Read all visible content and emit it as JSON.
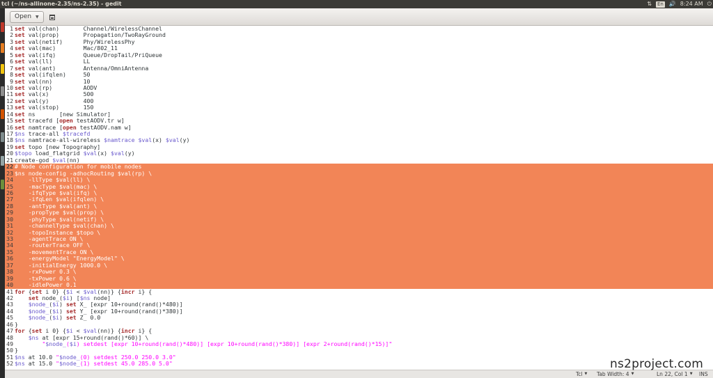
{
  "window": {
    "title": "tcl (~/ns-allinone-2.35/ns-2.35) - gedit"
  },
  "tray": {
    "keyboard": "En",
    "volume_icon": "speaker-icon",
    "time": "8:24 AM",
    "user": "L"
  },
  "toolbar": {
    "open_label": "Open"
  },
  "colors": {
    "selection": "#f28557",
    "keyword": "#a52a2a",
    "variable": "#6a5acd",
    "string": "#ff00ff",
    "comment": "#0000ff"
  },
  "editor": {
    "lines": [
      {
        "n": "1",
        "text": "set val(chan)       Channel/WirelessChannel"
      },
      {
        "n": "2",
        "text": "set val(prop)       Propagation/TwoRayGround"
      },
      {
        "n": "3",
        "text": "set val(netif)      Phy/WirelessPhy"
      },
      {
        "n": "4",
        "text": "set val(mac)        Mac/802_11"
      },
      {
        "n": "5",
        "text": "set val(ifq)        Queue/DropTail/PriQueue"
      },
      {
        "n": "6",
        "text": "set val(ll)         LL"
      },
      {
        "n": "7",
        "text": "set val(ant)        Antenna/OmniAntenna"
      },
      {
        "n": "8",
        "text": "set val(ifqlen)     50"
      },
      {
        "n": "9",
        "text": "set val(nn)         10"
      },
      {
        "n": "10",
        "text": "set val(rp)         AODV"
      },
      {
        "n": "11",
        "text": "set val(x)          500"
      },
      {
        "n": "12",
        "text": "set val(y)          400"
      },
      {
        "n": "13",
        "text": "set val(stop)       150"
      },
      {
        "n": "14",
        "text": "set ns       [new Simulator]"
      },
      {
        "n": "15",
        "text": "set tracefd [open testAODV.tr w]"
      },
      {
        "n": "16",
        "text": "set namtrace [open testAODV.nam w]"
      },
      {
        "n": "17",
        "text": "$ns trace-all $tracefd"
      },
      {
        "n": "18",
        "text": "$ns namtrace-all-wireless $namtrace $val(x) $val(y)"
      },
      {
        "n": "19",
        "text": "set topo [new Topography]"
      },
      {
        "n": "20",
        "text": "$topo load_flatgrid $val(x) $val(y)"
      },
      {
        "n": "21",
        "text": "create-god $val(nn)"
      },
      {
        "n": "22",
        "text": "# Node configuration for mobile nodes",
        "hl": true
      },
      {
        "n": "23",
        "text": "$ns node-config -adhocRouting $val(rp) \\",
        "hl": true
      },
      {
        "n": "24",
        "text": "    -llType $val(ll) \\",
        "hl": true
      },
      {
        "n": "25",
        "text": "    -macType $val(mac) \\",
        "hl": true
      },
      {
        "n": "26",
        "text": "    -ifqType $val(ifq) \\",
        "hl": true
      },
      {
        "n": "27",
        "text": "    -ifqLen $val(ifqlen) \\",
        "hl": true
      },
      {
        "n": "28",
        "text": "    -antType $val(ant) \\",
        "hl": true
      },
      {
        "n": "29",
        "text": "    -propType $val(prop) \\",
        "hl": true
      },
      {
        "n": "30",
        "text": "    -phyType $val(netif) \\",
        "hl": true
      },
      {
        "n": "31",
        "text": "    -channelType $val(chan) \\",
        "hl": true
      },
      {
        "n": "32",
        "text": "    -topoInstance $topo \\",
        "hl": true
      },
      {
        "n": "33",
        "text": "    -agentTrace ON \\",
        "hl": true
      },
      {
        "n": "34",
        "text": "    -routerTrace OFF \\",
        "hl": true
      },
      {
        "n": "35",
        "text": "    -movementTrace ON \\",
        "hl": true
      },
      {
        "n": "36",
        "text": "    -energyModel \"EnergyModel\" \\",
        "hl": true
      },
      {
        "n": "37",
        "text": "    -initialEnergy 1000.0 \\",
        "hl": true
      },
      {
        "n": "38",
        "text": "    -rxPower 0.3 \\",
        "hl": true
      },
      {
        "n": "39",
        "text": "    -txPower 0.6 \\",
        "hl": true
      },
      {
        "n": "40",
        "text": "    -idlePower 0.1",
        "hl": true
      },
      {
        "n": "41",
        "text": "for {set i 0} {$i < $val(nn)} {incr i} {"
      },
      {
        "n": "42",
        "text": "    set node_($i) [$ns node]"
      },
      {
        "n": "43",
        "text": "    $node_($i) set X_ [expr 10+round(rand()*480)]"
      },
      {
        "n": "44",
        "text": "    $node_($i) set Y_ [expr 10+round(rand()*380)]"
      },
      {
        "n": "45",
        "text": "    $node_($i) set Z_ 0.0"
      },
      {
        "n": "46",
        "text": "}"
      },
      {
        "n": "47",
        "text": "for {set i 0} {$i < $val(nn)} {incr i} {"
      },
      {
        "n": "48",
        "text": "    $ns at [expr 15+round(rand()*60)] \\"
      },
      {
        "n": "49",
        "text": "        \"$node_($i) setdest [expr 10+round(rand()*480)] [expr 10+round(rand()*380)] [expr 2+round(rand()*15)]\""
      },
      {
        "n": "50",
        "text": "}"
      },
      {
        "n": "51",
        "text": "$ns at 10.0 \"$node_(0) setdest 250.0 250.0 3.0\""
      },
      {
        "n": "52",
        "text": "$ns at 15.0 \"$node_(1) setdest 45.0 285.0 5.0\""
      }
    ]
  },
  "statusbar": {
    "language": "Tcl",
    "tab_width": "Tab Width: 4",
    "position": "Ln 22, Col 1",
    "mode": "INS"
  },
  "watermark": "ns2project.com"
}
